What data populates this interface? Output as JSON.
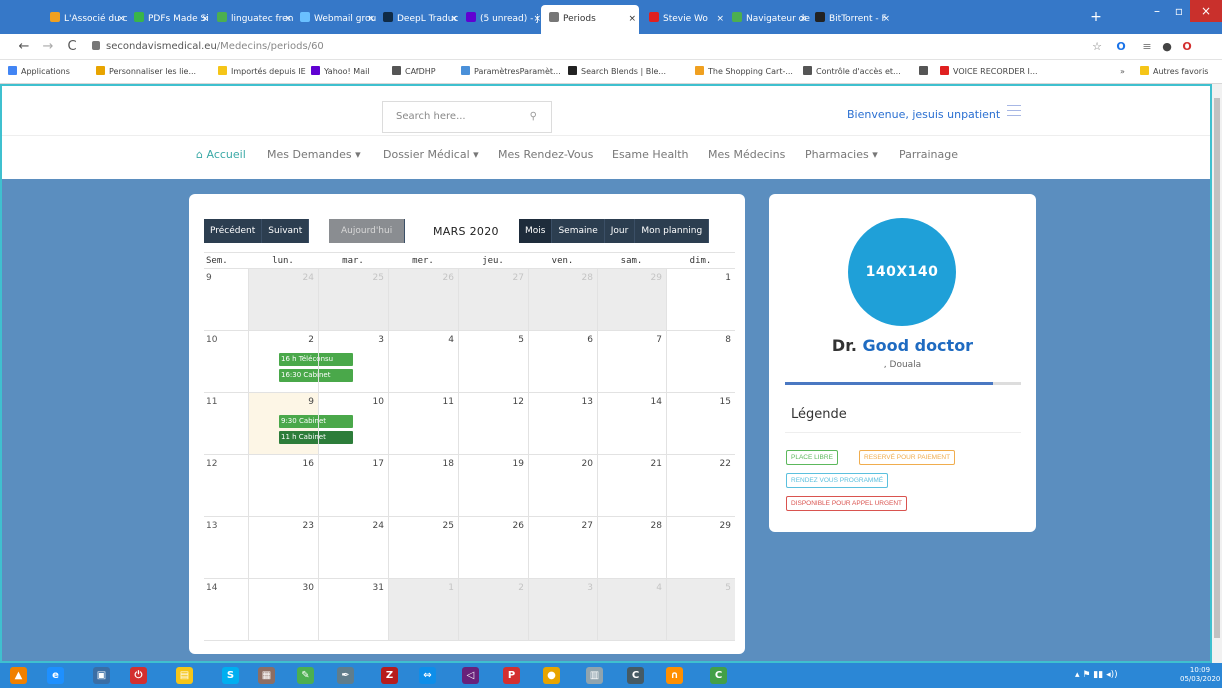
{
  "browser": {
    "tabs": [
      {
        "label": "L'Associé du c",
        "color": "#f0a020"
      },
      {
        "label": "PDFs Made Si",
        "color": "#39b54a"
      },
      {
        "label": "linguatec fren",
        "color": "#4caf50"
      },
      {
        "label": "Webmail grou",
        "color": "#6ac0ff"
      },
      {
        "label": "DeepL Traduc",
        "color": "#0f2b46"
      },
      {
        "label": "(5 unread) - j",
        "color": "#6001d2"
      },
      {
        "label": "Periods",
        "color": "#777777",
        "active": true
      },
      {
        "label": "Stevie Wo",
        "color": "#e02020"
      },
      {
        "label": "Navigateur de",
        "color": "#4caf50"
      },
      {
        "label": "BitTorrent - F",
        "color": "#222222"
      }
    ],
    "new_tab": "+",
    "window": {
      "minimize": "–",
      "maximize": "▫",
      "close": "×"
    },
    "nav": {
      "back": "←",
      "forward": "→",
      "reload": "C"
    },
    "url_host": "secondavismedical.eu",
    "url_path": "/Medecins/periods/60",
    "bookmarks": [
      {
        "label": "Applications",
        "color": "#4285f4"
      },
      {
        "label": "Personnaliser les lie...",
        "color": "#e8a400"
      },
      {
        "label": "Importés depuis IE",
        "color": "#f5c518"
      },
      {
        "label": "Yahoo! Mail",
        "color": "#6001d2"
      },
      {
        "label": "CAfDHP",
        "color": "#555555"
      },
      {
        "label": "ParamètresParamèt...",
        "color": "#4a90d9"
      },
      {
        "label": "Search Blends | Ble...",
        "color": "#222222"
      },
      {
        "label": "The Shopping Cart-...",
        "color": "#f0a020"
      },
      {
        "label": "Contrôle d'accès et...",
        "color": "#555555"
      },
      {
        "label": "",
        "color": "#555555"
      },
      {
        "label": "VOICE RECORDER I...",
        "color": "#e02020"
      }
    ],
    "other_bookmarks": "Autres favoris",
    "overflow": "»"
  },
  "site": {
    "search_placeholder": "Search here...",
    "welcome": "Bienvenue, jesuis unpatient",
    "nav": [
      "Accueil",
      "Mes Demandes ▾",
      "Dossier Médical ▾",
      "Mes Rendez-Vous",
      "Esame Health",
      "Mes Médecins",
      "Pharmacies ▾",
      "Parrainage"
    ]
  },
  "calendar": {
    "buttons_nav": [
      "Précédent",
      "Suivant"
    ],
    "button_today": "Aujourd'hui",
    "title": "MARS 2020",
    "buttons_view": [
      "Mois",
      "Semaine",
      "Jour",
      "Mon planning"
    ],
    "active_view": "Mois",
    "headers": [
      "Sem.",
      "lun.",
      "mar.",
      "mer.",
      "jeu.",
      "ven.",
      "sam.",
      "dim."
    ],
    "weeks": [
      {
        "num": "9",
        "days": [
          "24",
          "25",
          "26",
          "27",
          "28",
          "29",
          "1"
        ],
        "out": [
          true,
          true,
          true,
          true,
          true,
          true,
          false
        ]
      },
      {
        "num": "10",
        "days": [
          "2",
          "3",
          "4",
          "5",
          "6",
          "7",
          "8"
        ],
        "out": [
          false,
          false,
          false,
          false,
          false,
          false,
          false
        ]
      },
      {
        "num": "11",
        "days": [
          "9",
          "10",
          "11",
          "12",
          "13",
          "14",
          "15"
        ],
        "out": [
          false,
          false,
          false,
          false,
          false,
          false,
          false
        ]
      },
      {
        "num": "12",
        "days": [
          "16",
          "17",
          "18",
          "19",
          "20",
          "21",
          "22"
        ],
        "out": [
          false,
          false,
          false,
          false,
          false,
          false,
          false
        ]
      },
      {
        "num": "13",
        "days": [
          "23",
          "24",
          "25",
          "26",
          "27",
          "28",
          "29"
        ],
        "out": [
          false,
          false,
          false,
          false,
          false,
          false,
          false
        ]
      },
      {
        "num": "14",
        "days": [
          "30",
          "31",
          "1",
          "2",
          "3",
          "4",
          "5"
        ],
        "out": [
          false,
          false,
          true,
          true,
          true,
          true,
          true
        ]
      }
    ],
    "today": {
      "week": 2,
      "day": 0
    },
    "events": [
      {
        "week": 1,
        "day": 0,
        "slot": 0,
        "label": "16 h Téléconsu",
        "style": "green"
      },
      {
        "week": 1,
        "day": 0,
        "slot": 1,
        "label": "16:30 Cabinet",
        "style": "green"
      },
      {
        "week": 2,
        "day": 0,
        "slot": 0,
        "label": "9:30 Cabinet",
        "style": "green"
      },
      {
        "week": 2,
        "day": 0,
        "slot": 1,
        "label": "11 h Cabinet",
        "style": "dgreen"
      }
    ]
  },
  "doctor": {
    "avatar_text": "140X140",
    "title_prefix": "Dr.",
    "name": "Good doctor",
    "city": ", Douala",
    "progress": 0.88,
    "legend_title": "Légende",
    "legend": [
      {
        "label": "PLACE LIBRE",
        "color": "#5cb85c"
      },
      {
        "label": "RESERVÉ POUR PAIEMENT",
        "color": "#f0ad4e"
      },
      {
        "label": "RENDEZ VOUS PROGRAMMÉ",
        "color": "#5bc0de"
      },
      {
        "label": "DISPONIBLE POUR APPEL URGENT",
        "color": "#d9534f"
      }
    ]
  },
  "taskbar": {
    "icons": [
      {
        "name": "vlc-icon",
        "glyph": "▲",
        "color": "#f08000"
      },
      {
        "name": "internet-explorer-icon",
        "glyph": "e",
        "color": "#1e90ff"
      },
      {
        "name": "network-icon",
        "glyph": "▣",
        "color": "#3a6ea5"
      },
      {
        "name": "power-icon",
        "glyph": "⏻",
        "color": "#d32f2f"
      },
      {
        "name": "file-explorer-icon",
        "glyph": "▤",
        "color": "#f5c518"
      },
      {
        "name": "skype-icon",
        "glyph": "S",
        "color": "#00aff0"
      },
      {
        "name": "notepad-icon",
        "glyph": "▦",
        "color": "#8d6e63"
      },
      {
        "name": "paint-icon",
        "glyph": "✎",
        "color": "#4caf50"
      },
      {
        "name": "pen-icon",
        "glyph": "✒",
        "color": "#607d8b"
      },
      {
        "name": "filezilla-icon",
        "glyph": "Z",
        "color": "#b71c1c"
      },
      {
        "name": "teamviewer-icon",
        "glyph": "⇔",
        "color": "#0e8ee9"
      },
      {
        "name": "visual-studio-icon",
        "glyph": "◁",
        "color": "#68217a"
      },
      {
        "name": "pdf-icon",
        "glyph": "P",
        "color": "#d32f2f"
      },
      {
        "name": "chrome-icon",
        "glyph": "●",
        "color": "#e8a400"
      },
      {
        "name": "document-icon",
        "glyph": "▥",
        "color": "#90a4ae"
      },
      {
        "name": "ccleaner-icon",
        "glyph": "C",
        "color": "#455a64"
      },
      {
        "name": "vpn-icon",
        "glyph": "∩",
        "color": "#ff8f00"
      },
      {
        "name": "camtasia-icon",
        "glyph": "C",
        "color": "#43a047"
      }
    ],
    "time": "10:09",
    "date": "05/03/2020"
  }
}
